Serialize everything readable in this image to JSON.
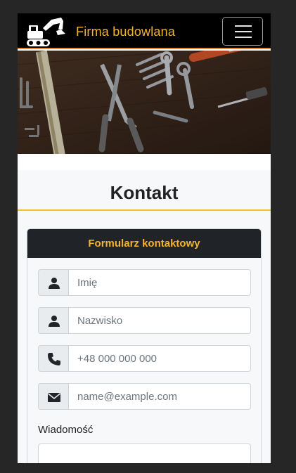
{
  "navbar": {
    "brand": "Firma budowlana",
    "logo_icon": "excavator-icon",
    "toggle_icon": "hamburger-menu-icon"
  },
  "colors": {
    "accent": "#f3b32a",
    "navbar_border": "#e8892b",
    "heading_underline": "#f3c12a",
    "card_header_bg": "#202327"
  },
  "hero": {
    "image": "tools-on-wooden-table"
  },
  "section": {
    "title": "Kontakt"
  },
  "form": {
    "header": "Formularz kontaktowy",
    "first_name": {
      "placeholder": "Imię",
      "icon": "user-icon"
    },
    "last_name": {
      "placeholder": "Nazwisko",
      "icon": "user-icon"
    },
    "phone": {
      "placeholder": "+48 000 000 000",
      "icon": "phone-icon"
    },
    "email": {
      "placeholder": "name@example.com",
      "icon": "envelope-icon"
    },
    "message_label": "Wiadomość"
  }
}
